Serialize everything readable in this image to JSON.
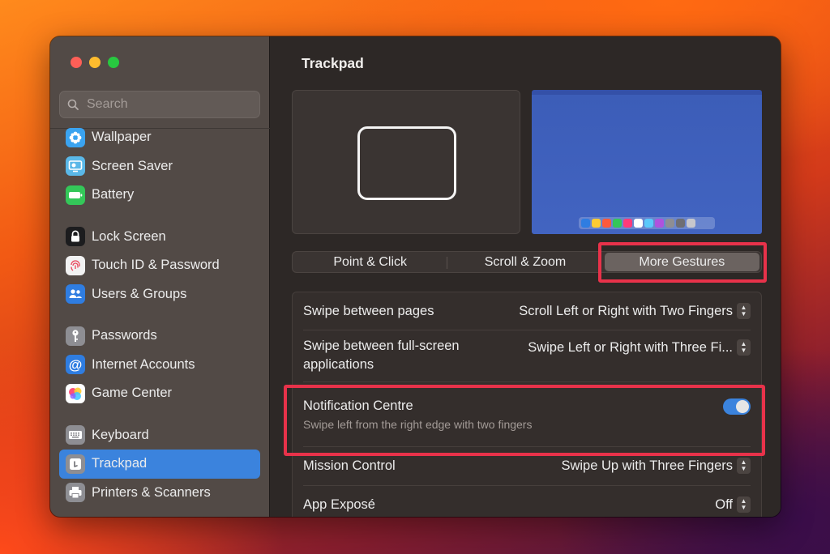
{
  "window": {
    "title": "Trackpad"
  },
  "search": {
    "placeholder": "Search"
  },
  "sidebar": {
    "items": [
      {
        "label": "Wallpaper",
        "icon": "wallpaper-icon",
        "color": "#3aa3f0"
      },
      {
        "label": "Screen Saver",
        "icon": "screen-saver-icon",
        "color": "#5ab8e8"
      },
      {
        "label": "Battery",
        "icon": "battery-icon",
        "color": "#34c759"
      },
      {
        "label": "Lock Screen",
        "icon": "lock-icon",
        "color": "#1c1c1e"
      },
      {
        "label": "Touch ID & Password",
        "icon": "fingerprint-icon",
        "color": "#f2f2f2"
      },
      {
        "label": "Users & Groups",
        "icon": "users-icon",
        "color": "#2f7de1"
      },
      {
        "label": "Passwords",
        "icon": "key-icon",
        "color": "#8e8e93"
      },
      {
        "label": "Internet Accounts",
        "icon": "at-icon",
        "color": "#2f7de1"
      },
      {
        "label": "Game Center",
        "icon": "game-center-icon",
        "color": "#ffffff"
      },
      {
        "label": "Keyboard",
        "icon": "keyboard-icon",
        "color": "#8e8e93"
      },
      {
        "label": "Trackpad",
        "icon": "trackpad-icon",
        "color": "#8e8e93"
      },
      {
        "label": "Printers & Scanners",
        "icon": "printer-icon",
        "color": "#8e8e93"
      }
    ],
    "active": "Trackpad"
  },
  "tabs": [
    {
      "label": "Point & Click"
    },
    {
      "label": "Scroll & Zoom"
    },
    {
      "label": "More Gestures"
    }
  ],
  "selected_tab": "More Gestures",
  "settings": {
    "swipe_pages": {
      "label": "Swipe between pages",
      "value": "Scroll Left or Right with Two Fingers"
    },
    "swipe_fullscreen": {
      "label_line1": "Swipe between full-screen",
      "label_line2": "applications",
      "value": "Swipe Left or Right with Three Fi..."
    },
    "notification_centre": {
      "label": "Notification Centre",
      "description": "Swipe left from the right edge with two fingers",
      "enabled": true
    },
    "mission_control": {
      "label": "Mission Control",
      "value": "Swipe Up with Three Fingers"
    },
    "app_expose": {
      "label": "App Exposé",
      "value": "Off"
    }
  },
  "colors": {
    "accent": "#3b83dd",
    "highlight": "#e8324a"
  }
}
